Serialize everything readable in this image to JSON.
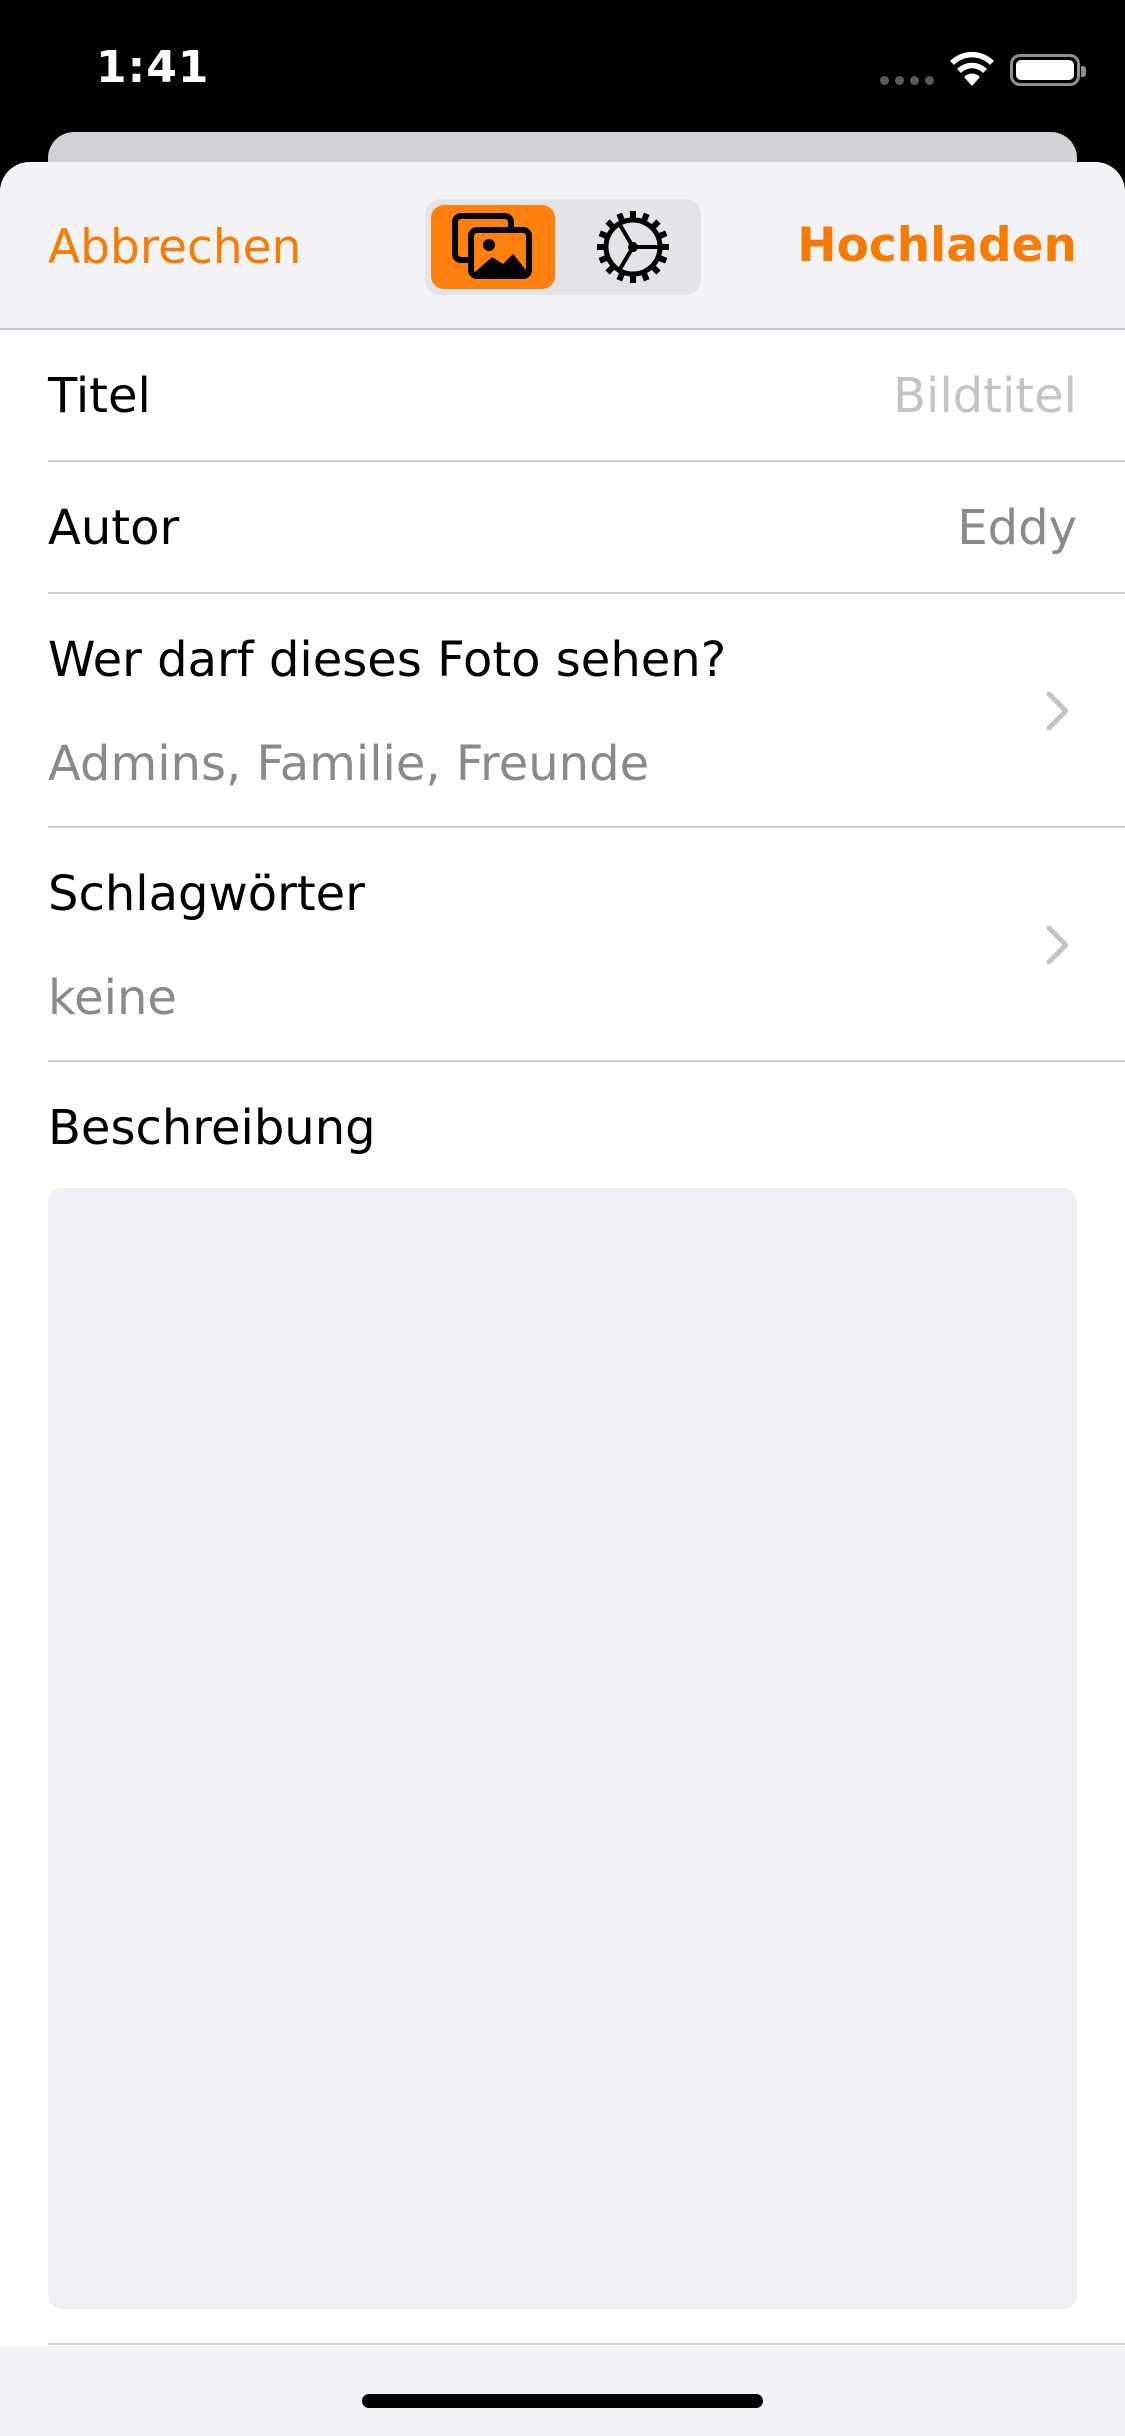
{
  "status_bar": {
    "time": "1:41"
  },
  "navbar": {
    "cancel_label": "Abbrechen",
    "upload_label": "Hochladen",
    "segments": [
      {
        "icon": "photos-icon",
        "selected": true
      },
      {
        "icon": "gear-settings-icon",
        "selected": false
      }
    ]
  },
  "form": {
    "title": {
      "label": "Titel",
      "placeholder": "Bildtitel"
    },
    "author": {
      "label": "Autor",
      "value": "Eddy"
    },
    "visibility": {
      "label": "Wer darf dieses Foto sehen?",
      "value": "Admins, Familie, Freunde"
    },
    "tags": {
      "label": "Schlagwörter",
      "value": "keine"
    },
    "description": {
      "label": "Beschreibung",
      "value": ""
    }
  },
  "colors": {
    "accent": "#ff7f0f",
    "accent_text": "#f57c00",
    "nav_background": "#f2f2f7",
    "field_background": "#efeff4"
  }
}
